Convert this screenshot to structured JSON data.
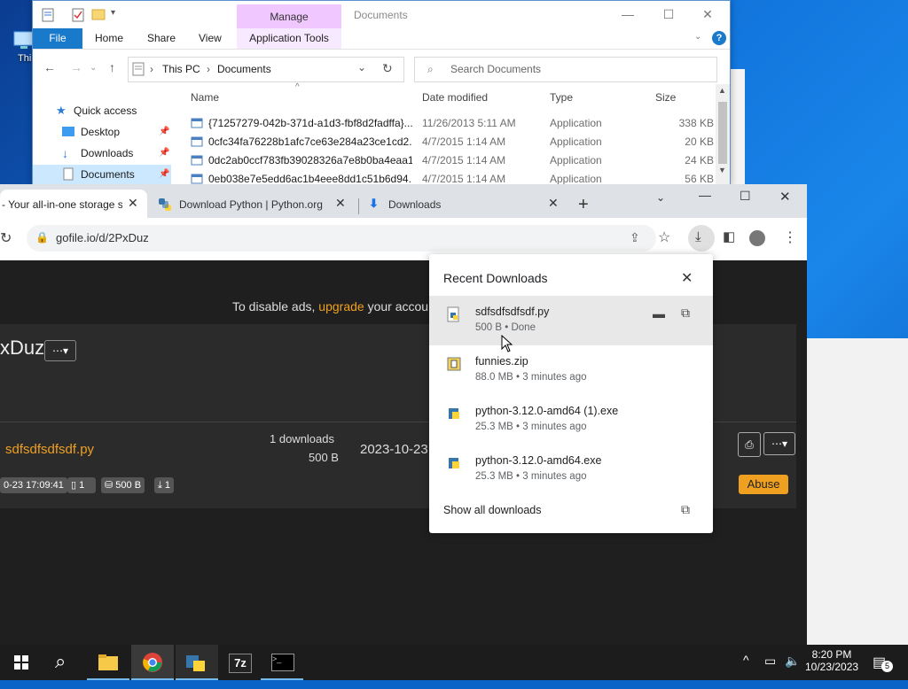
{
  "desktop": {
    "icon_label": "Thi"
  },
  "explorer": {
    "manage_tab": "Manage",
    "title": "Documents",
    "ribbon": {
      "file": "File",
      "home": "Home",
      "share": "Share",
      "view": "View",
      "app_tools": "Application Tools"
    },
    "address": {
      "this_pc": "This PC",
      "documents": "Documents"
    },
    "search_placeholder": "Search Documents",
    "nav": [
      {
        "label": "Quick access"
      },
      {
        "label": "Desktop"
      },
      {
        "label": "Downloads"
      },
      {
        "label": "Documents"
      }
    ],
    "columns": {
      "name": "Name",
      "date": "Date modified",
      "type": "Type",
      "size": "Size"
    },
    "files": [
      {
        "name": "{71257279-042b-371d-a1d3-fbf8d2fadffa}...",
        "date": "11/26/2013 5:11 AM",
        "type": "Application",
        "size": "338 KB"
      },
      {
        "name": "0cfc34fa76228b1afc7ce63e284a23ce1cd2...",
        "date": "4/7/2015 1:14 AM",
        "type": "Application",
        "size": "20 KB"
      },
      {
        "name": "0dc2ab0ccf783fb39028326a7e8b0ba4eaa1...",
        "date": "4/7/2015 1:14 AM",
        "type": "Application",
        "size": "24 KB"
      },
      {
        "name": "0eb038e7e5edd6ac1b4eee8dd1c51b6d94...",
        "date": "4/7/2015 1:14 AM",
        "type": "Application",
        "size": "56 KB"
      }
    ]
  },
  "chrome": {
    "tabs": [
      {
        "label": "- Your all-in-one storage s"
      },
      {
        "label": "Download Python | Python.org"
      },
      {
        "label": "Downloads"
      }
    ],
    "url": "gofile.io/d/2PxDuz",
    "page": {
      "ad_text": "To disable ads,",
      "ad_link": "upgrade",
      "ad_rest": "your accou",
      "folder_code": "xDuz",
      "file_name": "sdfsdfsdfsdf.py",
      "downloads": "1 downloads",
      "size": "500 B",
      "date": "2023-10-23",
      "pill_date": "0-23 17:09:41",
      "pill_count": "1",
      "pill_size": "500 B",
      "pill_dl": "1",
      "abuse": "Abuse"
    }
  },
  "downloads_panel": {
    "title": "Recent Downloads",
    "items": [
      {
        "name": "sdfsdfsdfsdf.py",
        "meta": "500 B • Done"
      },
      {
        "name": "funnies.zip",
        "meta": "88.0 MB • 3 minutes ago"
      },
      {
        "name": "python-3.12.0-amd64 (1).exe",
        "meta": "25.3 MB • 3 minutes ago"
      },
      {
        "name": "python-3.12.0-amd64.exe",
        "meta": "25.3 MB • 3 minutes ago"
      }
    ],
    "show_all": "Show all downloads"
  },
  "taskbar": {
    "time": "8:20 PM",
    "date": "10/23/2023",
    "notifications": "5"
  }
}
